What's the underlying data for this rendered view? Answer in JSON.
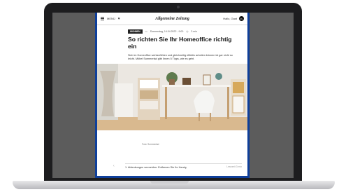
{
  "topbar": {
    "menu_label": "MENÜ",
    "brand": "Allgemeine Zeitung",
    "login_label": "Hallo, Gast",
    "avatar_initials": "ZL"
  },
  "article": {
    "badge": "WOHNEN",
    "date": "Donnerstag, 14.04.2022 - 9:00",
    "read_time": "3 min",
    "headline": "So richten Sie Ihr Homeoffice richtig ein",
    "lead": "Sich im Homeoffice wohlzufühlen und gleichzeitig effektiv arbeiten können ist gar nicht so leicht. Möbel Sommerlad gibt Ihnen 5 Tipps, wie es geht.",
    "author_prefix": "Von",
    "author_name": "Partner",
    "image_caption": "Foto: Sommerlad",
    "list_item_1": "1. Ablenkungen vermeiden: Entfernen Sie Ihr Handy,",
    "bottom_right": "Lesezeit 3 min"
  },
  "colors": {
    "frame_accent": "#0f3f9a",
    "laptop_body": "#1d1d1f"
  }
}
